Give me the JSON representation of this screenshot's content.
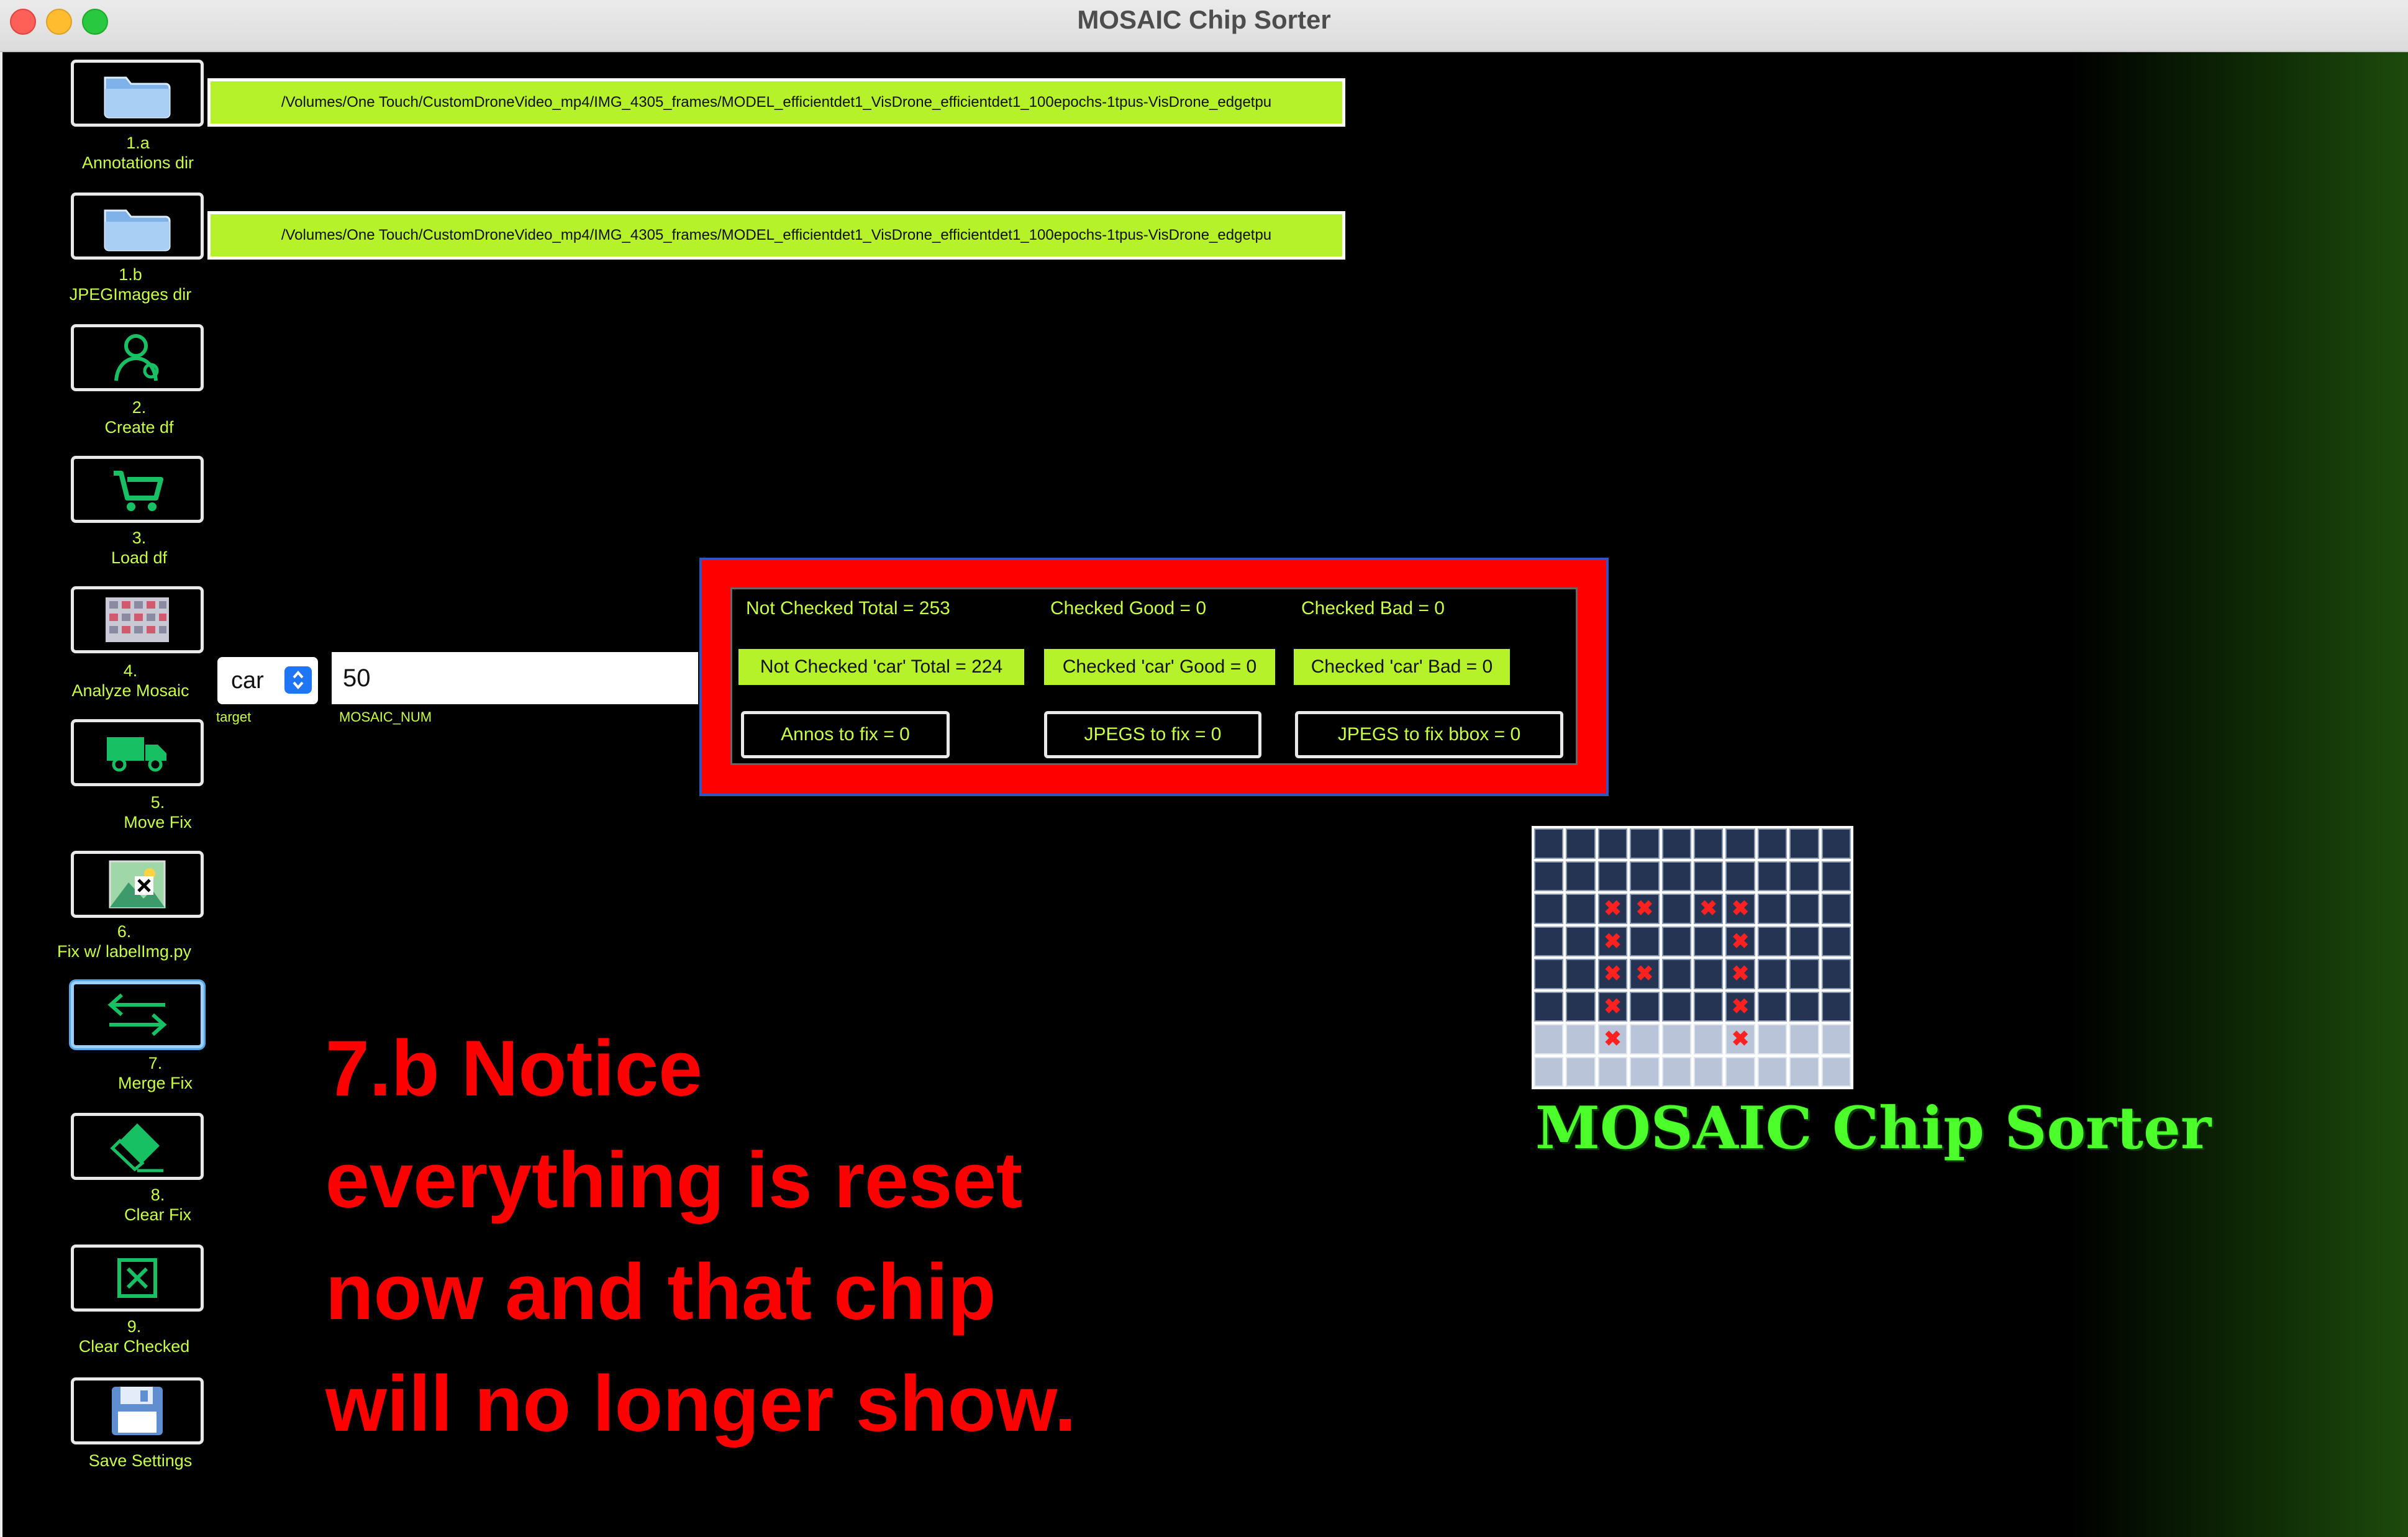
{
  "window": {
    "title": "MOSAIC Chip Sorter",
    "controls": [
      "close",
      "minimize",
      "maximize"
    ]
  },
  "sidebar": {
    "items": [
      {
        "number": "1.a",
        "label": "Annotations dir",
        "icon": "folder-icon"
      },
      {
        "number": "1.b",
        "label": "JPEGImages dir",
        "icon": "folder-icon"
      },
      {
        "number": "2.",
        "label": "Create df",
        "icon": "person-icon"
      },
      {
        "number": "3.",
        "label": "Load df",
        "icon": "cart-icon"
      },
      {
        "number": "4.",
        "label": "Analyze Mosaic",
        "icon": "mosaic-icon"
      },
      {
        "number": "5.",
        "label": "Move Fix",
        "icon": "truck-icon"
      },
      {
        "number": "6.",
        "label": "Fix w/ labelImg.py",
        "icon": "image-edit-icon"
      },
      {
        "number": "7.",
        "label": "Merge Fix",
        "icon": "swap-arrows-icon"
      },
      {
        "number": "8.",
        "label": "Clear Fix",
        "icon": "eraser-icon"
      },
      {
        "number": "9.",
        "label": "Clear Checked",
        "icon": "checkbox-x-icon"
      },
      {
        "number": "",
        "label": "Save Settings",
        "icon": "floppy-disk-icon"
      }
    ]
  },
  "paths": {
    "annotations_dir": "/Volumes/One Touch/CustomDroneVideo_mp4/IMG_4305_frames/MODEL_efficientdet1_VisDrone_efficientdet1_100epochs-1tpus-VisDrone_edgetpu",
    "jpegimages_dir": "/Volumes/One Touch/CustomDroneVideo_mp4/IMG_4305_frames/MODEL_efficientdet1_VisDrone_efficientdet1_100epochs-1tpus-VisDrone_edgetpu"
  },
  "controls": {
    "target_value": "car",
    "target_label": "target",
    "mosaic_num_value": "50",
    "mosaic_num_label": "MOSAIC_NUM"
  },
  "stats": {
    "not_checked_total": "Not Checked Total = 253",
    "checked_good": "Checked Good = 0",
    "checked_bad": "Checked Bad = 0",
    "not_checked_car_total": "Not Checked 'car' Total = 224",
    "checked_car_good": "Checked 'car' Good = 0",
    "checked_car_bad": "Checked 'car' Bad = 0",
    "annos_to_fix": "Annos to fix = 0",
    "jpegs_to_fix": "JPEGS to fix = 0",
    "jpegs_to_fix_bbox": "JPEGS to fix bbox = 0"
  },
  "notice": {
    "lines": [
      "7.b  Notice",
      "everything is reset",
      "now and that chip",
      "will no longer show."
    ]
  },
  "logo": {
    "text": "MOSAIC Chip Sorter"
  },
  "colors": {
    "accent_green": "#b6f22a",
    "label_green": "#c8ff40",
    "alert_red": "#ff0000",
    "logo_green": "#4cff2a"
  }
}
